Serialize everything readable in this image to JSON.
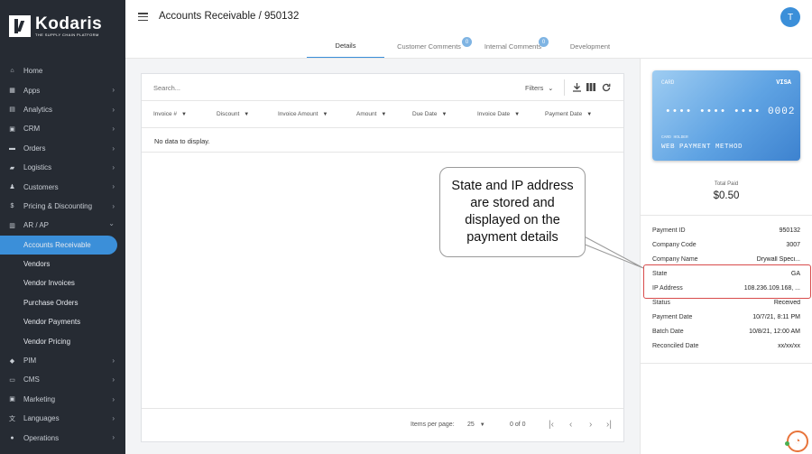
{
  "brand": {
    "name": "Kodaris",
    "tagline": "THE SUPPLY CHAIN PLATFORM"
  },
  "sidebar": {
    "items": [
      {
        "label": "Home",
        "icon": "home-icon",
        "chevron": false
      },
      {
        "label": "Apps",
        "icon": "apps-icon",
        "chevron": true
      },
      {
        "label": "Analytics",
        "icon": "analytics-icon",
        "chevron": true
      },
      {
        "label": "CRM",
        "icon": "crm-icon",
        "chevron": true
      },
      {
        "label": "Orders",
        "icon": "orders-icon",
        "chevron": true
      },
      {
        "label": "Logistics",
        "icon": "truck-icon",
        "chevron": true
      },
      {
        "label": "Customers",
        "icon": "customers-icon",
        "chevron": true
      },
      {
        "label": "Pricing & Discounting",
        "icon": "dollar-icon",
        "chevron": true
      },
      {
        "label": "AR / AP",
        "icon": "bank-icon",
        "chevron": true
      },
      {
        "label": "Accounts Receivable",
        "sub": true,
        "active": true
      },
      {
        "label": "Vendors",
        "sub": true
      },
      {
        "label": "Vendor Invoices",
        "sub": true
      },
      {
        "label": "Purchase Orders",
        "sub": true
      },
      {
        "label": "Vendor Payments",
        "sub": true
      },
      {
        "label": "Vendor Pricing",
        "sub": true
      },
      {
        "label": "PIM",
        "icon": "tag-icon",
        "chevron": true
      },
      {
        "label": "CMS",
        "icon": "cms-icon",
        "chevron": true
      },
      {
        "label": "Marketing",
        "icon": "marketing-icon",
        "chevron": true
      },
      {
        "label": "Languages",
        "icon": "languages-icon",
        "chevron": true
      },
      {
        "label": "Operations",
        "icon": "operations-icon",
        "chevron": true
      }
    ]
  },
  "header": {
    "title": "Accounts Receivable / 950132",
    "avatar_initial": "T"
  },
  "tabs": [
    {
      "label": "Details",
      "active": true
    },
    {
      "label": "Customer Comments",
      "badge": "0"
    },
    {
      "label": "Internal Comments",
      "badge": "0"
    },
    {
      "label": "Development"
    }
  ],
  "table": {
    "search_placeholder": "Search...",
    "filters_label": "Filters",
    "columns": [
      "Invoice #",
      "Discount",
      "Invoice Amount",
      "Amount",
      "Due Date",
      "Invoice Date",
      "Payment Date"
    ],
    "empty_message": "No data to display.",
    "items_per_page_label": "Items per page:",
    "items_per_page_value": "25",
    "range_label": "0 of 0"
  },
  "card": {
    "top_label": "CARD",
    "brand": "VISA",
    "number": "•••• •••• •••• 0002",
    "holder_label": "CARD HOLDER",
    "method": "WEB PAYMENT METHOD"
  },
  "payment": {
    "total_label": "Total Paid",
    "total_value": "$0.50",
    "details": [
      {
        "label": "Payment ID",
        "value": "950132"
      },
      {
        "label": "Company Code",
        "value": "3007"
      },
      {
        "label": "Company Name",
        "value": "Drywall Speci..."
      },
      {
        "label": "State",
        "value": "GA"
      },
      {
        "label": "IP Address",
        "value": "108.236.109.168, ..."
      },
      {
        "label": "Status",
        "value": "Received"
      },
      {
        "label": "Payment Date",
        "value": "10/7/21, 8:11 PM"
      },
      {
        "label": "Batch Date",
        "value": "10/8/21, 12:00 AM"
      },
      {
        "label": "Reconciled Date",
        "value": "xx/xx/xx"
      }
    ]
  },
  "callout": {
    "text": "State and IP address are stored and displayed on the payment details"
  },
  "colors": {
    "sidebar_bg": "#262b33",
    "accent": "#3b8fd9",
    "highlight": "#d84b4b",
    "chat": "#e8743b"
  }
}
